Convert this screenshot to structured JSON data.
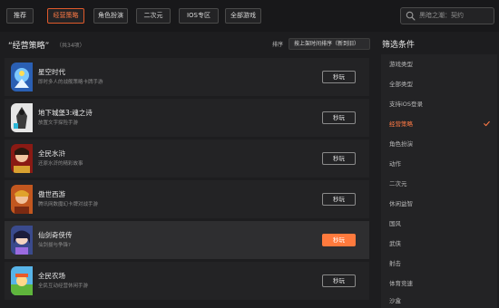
{
  "topbar": {
    "tabs": [
      {
        "label": "推荐",
        "active": false
      },
      {
        "label": "经营策略",
        "active": true
      },
      {
        "label": "角色扮演",
        "active": false
      },
      {
        "label": "二次元",
        "active": false
      },
      {
        "label": "IOS专区",
        "active": false
      },
      {
        "label": "全部游戏",
        "active": false
      }
    ],
    "search_placeholder": "黑暗之潮：契约"
  },
  "list": {
    "heading": "“经营策略”",
    "count": "（共34项）",
    "sort_label": "排序",
    "sort_value": "按上架时间排序（新到旧）",
    "games": [
      {
        "name": "星空时代",
        "desc": "即时多人的战舰策略卡牌手游",
        "play": "秒玩",
        "icon": "starship-icon"
      },
      {
        "name": "地下城堡3:魂之诗",
        "desc": "放置文字探险手游",
        "play": "秒玩",
        "icon": "dungeon-icon"
      },
      {
        "name": "全民水浒",
        "desc": "还原水浒的精彩故事",
        "play": "秒玩",
        "icon": "hero-icon"
      },
      {
        "name": "傲世西游",
        "desc": "腾讯网数魔幻卡牌对战手游",
        "play": "秒玩",
        "icon": "journey-icon"
      },
      {
        "name": "仙剑奇侠传",
        "desc": "仙剑拔与争锋?",
        "play": "秒玩",
        "icon": "sword-fairy-icon"
      },
      {
        "name": "全民农场",
        "desc": "全民互动经营休闲手游",
        "play": "秒玩",
        "icon": "farm-icon"
      }
    ]
  },
  "filters": {
    "title": "筛选条件",
    "items": [
      {
        "label": "游戏类型",
        "active": false
      },
      {
        "label": "全部类型",
        "active": false
      },
      {
        "label": "支持iOS登录",
        "active": false
      },
      {
        "label": "经营策略",
        "active": true
      },
      {
        "label": "角色扮演",
        "active": false
      },
      {
        "label": "动作",
        "active": false
      },
      {
        "label": "二次元",
        "active": false
      },
      {
        "label": "休闲益智",
        "active": false
      },
      {
        "label": "国风",
        "active": false
      },
      {
        "label": "武侠",
        "active": false
      },
      {
        "label": "射击",
        "active": false
      },
      {
        "label": "体育竞速",
        "active": false
      },
      {
        "label": "沙盒",
        "active": false
      }
    ]
  },
  "colors": {
    "accent": "#ff7a45",
    "button_orange": "#ff7a3d",
    "bg": "#1d1d1f"
  }
}
